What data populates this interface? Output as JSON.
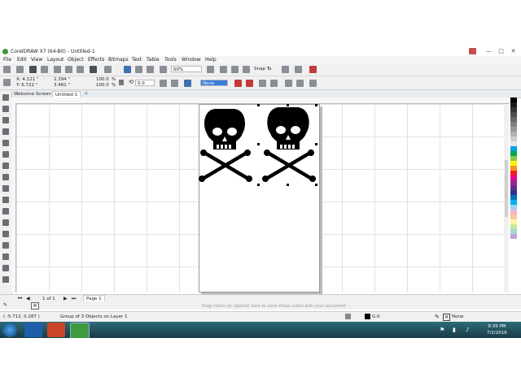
{
  "window": {
    "title": "CorelDRAW X7 (64-Bit) - Untitled-1",
    "controls": [
      "—",
      "□",
      "✕"
    ]
  },
  "menu": [
    "File",
    "Edit",
    "View",
    "Layout",
    "Object",
    "Effects",
    "Bitmaps",
    "Text",
    "Table",
    "Tools",
    "Window",
    "Help"
  ],
  "toolbar1": {
    "zoom_value": "60%",
    "snap_label": "Snap To"
  },
  "propbar": {
    "x": "X: 4.121 \"",
    "y": "Y: 6.722 \"",
    "width": "2.394 \"",
    "height": "3.481 \"",
    "scale_w": "100.0",
    "scale_h": "100.0",
    "pct": "%",
    "angle": "0.0",
    "outline": "None"
  },
  "tabs": [
    "Welcome Screen",
    "Untitled-1"
  ],
  "docnav": {
    "page_count": "1 of 1",
    "page_tab": "Page 1"
  },
  "hint": "Drag colors (or objects) here to store these colors with your document",
  "status": {
    "coords": "( -5.712, 0.287 )",
    "selection": "Group of 3 Objects on Layer 1",
    "fill_label": "G:0",
    "outline_label": "None"
  },
  "taskbar": {
    "time": "9:39 PM",
    "date": "7/2/2016"
  },
  "colors": {
    "palette": [
      "#000000",
      "#1a1a1a",
      "#333333",
      "#4d4d4d",
      "#666666",
      "#808080",
      "#999999",
      "#b3b3b3",
      "#cccccc",
      "#e6e6e6",
      "#00a0e3",
      "#00a651",
      "#8dc63f",
      "#fff200",
      "#f7941d",
      "#ed1c24",
      "#ec008c",
      "#92278f",
      "#662d91",
      "#2e3192",
      "#0072bc",
      "#00aeef",
      "#a0d2f0",
      "#f5b4c8",
      "#f9c8a0",
      "#fff5a0",
      "#c8e6a0",
      "#a0dcc8",
      "#c8a0dc"
    ]
  }
}
